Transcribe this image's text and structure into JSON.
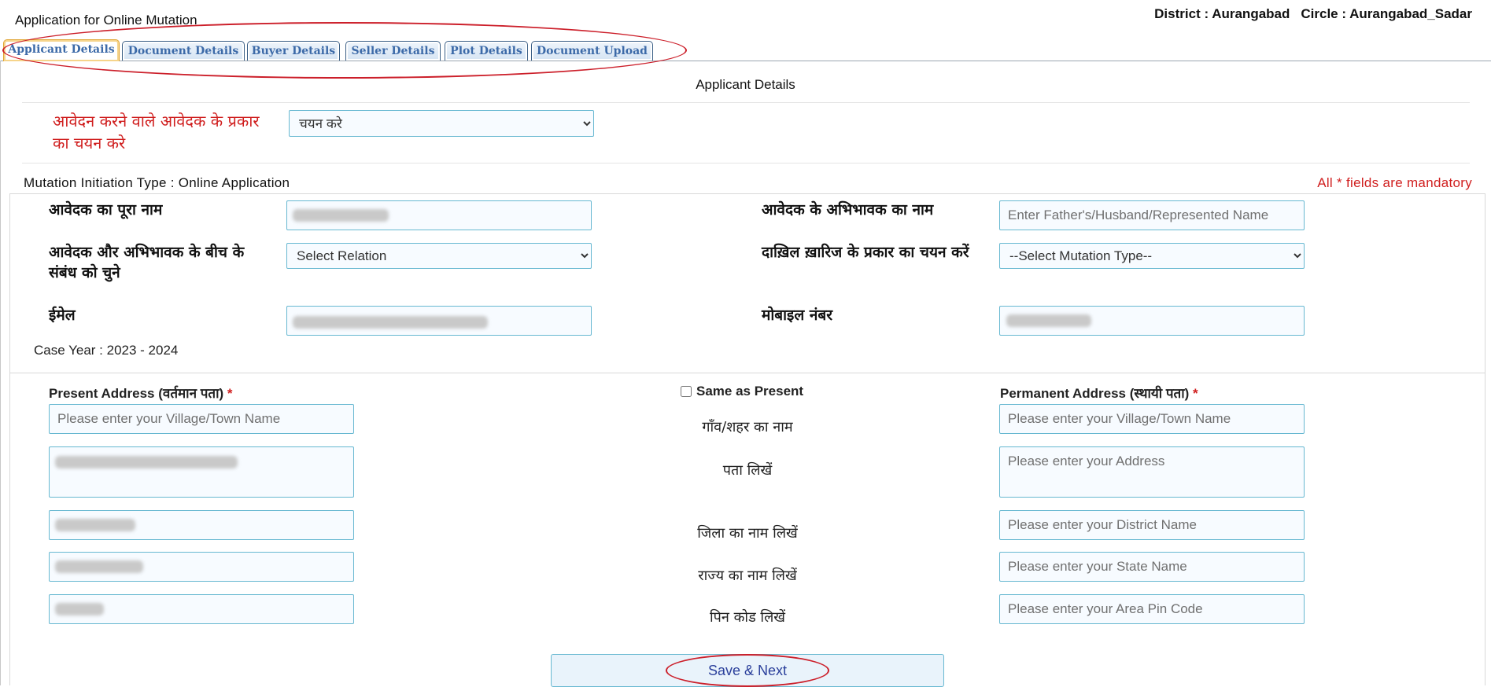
{
  "header": {
    "app_title": "Application for Online Mutation",
    "district_label": "District : Aurangabad",
    "circle_label": "Circle : Aurangabad_Sadar"
  },
  "tabs": [
    {
      "label": "Applicant Details",
      "active": true
    },
    {
      "label": "Document Details",
      "active": false
    },
    {
      "label": "Buyer Details",
      "active": false
    },
    {
      "label": "Seller Details",
      "active": false
    },
    {
      "label": "Plot Details",
      "active": false
    },
    {
      "label": "Document Upload",
      "active": false
    }
  ],
  "section_title": "Applicant Details",
  "applicant_type": {
    "label": "आवेदन करने वाले आवेदक के प्रकार का चयन करे",
    "selected": "चयन करे"
  },
  "mutation_initiation": "Mutation Initiation Type : Online Application",
  "mandatory_note": "All * fields are mandatory",
  "form": {
    "full_name_label": "आवेदक का पूरा नाम",
    "guardian_name_label": "आवेदक के अभिभावक का नाम",
    "guardian_name_placeholder": "Enter Father's/Husband/Represented Name",
    "relation_label": "आवेदक और अभिभावक के बीच के संबंध को चुने",
    "relation_selected": "Select Relation",
    "mutation_type_label": "दाख़िल ख़ारिज के प्रकार का चयन करें",
    "mutation_type_selected": "--Select Mutation Type--",
    "email_label": "ईमेल",
    "mobile_label": "मोबाइल नंबर",
    "case_year": "Case Year : 2023 - 2024"
  },
  "address": {
    "present_heading": "Present Address (वर्तमान पता)",
    "permanent_heading": "Permanent Address (स्थायी पता)",
    "required_mark": "*",
    "same_as_present": "Same as Present",
    "village_label": "गाँव/शहर का नाम",
    "address_label": "पता लिखें",
    "district_label": "जिला का नाम लिखें",
    "state_label": "राज्य का नाम लिखें",
    "pin_label": "पिन कोड लिखें",
    "village_placeholder": "Please enter your Village/Town Name",
    "address_placeholder": "Please enter your Address",
    "district_placeholder": "Please enter your District Name",
    "state_placeholder": "Please enter your State Name",
    "pin_placeholder": "Please enter your Area Pin Code"
  },
  "save_button": "Save & Next",
  "colors": {
    "accent_red": "#d01f1f",
    "tab_text": "#3c6aa8",
    "input_border": "#67b8d1",
    "button_text": "#2a3f9b"
  }
}
